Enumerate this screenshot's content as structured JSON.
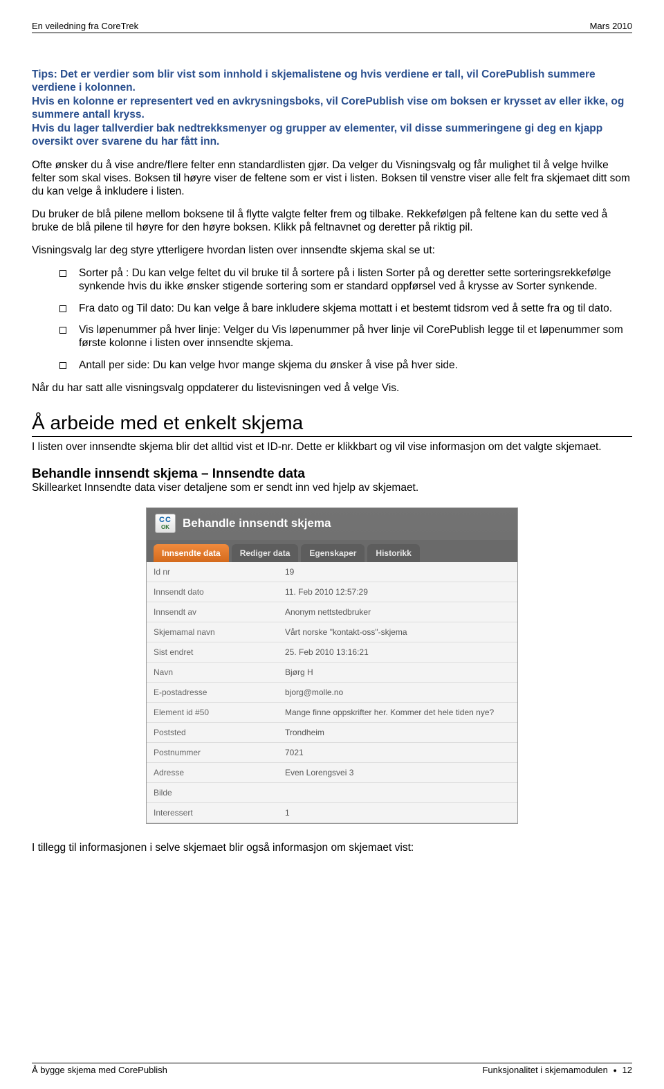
{
  "header": {
    "left": "En veiledning fra CoreTrek",
    "right": "Mars 2010"
  },
  "tips": "Tips: Det er verdier som blir vist som innhold i skjemalistene og hvis verdiene er tall, vil CorePublish summere verdiene i kolonnen.\nHvis en kolonne er representert ved en avkrysningsboks, vil CorePublish vise om boksen er krysset av eller ikke, og summere antall kryss.\nHvis du lager tallverdier bak nedtrekksmenyer og grupper av elementer, vil disse summeringene gi deg en kjapp oversikt over svarene du har fått inn.",
  "p1": "Ofte ønsker du å vise andre/flere felter enn standardlisten gjør. Da velger du Visningsvalg og får mulighet til å velge hvilke felter som skal vises. Boksen til høyre viser de feltene som er vist i listen. Boksen til venstre viser alle felt fra skjemaet ditt som du kan velge å inkludere i listen.",
  "p2": "Du bruker de blå pilene mellom boksene til å flytte valgte felter frem og tilbake. Rekkefølgen på feltene kan du sette ved å bruke de blå pilene til høyre for den høyre boksen. Klikk på feltnavnet og deretter på riktig pil.",
  "p3": "Visningsvalg lar deg styre ytterligere hvordan listen over innsendte skjema skal se ut:",
  "bullets": [
    "Sorter på : Du kan velge feltet du vil bruke til å sortere på i listen Sorter på og deretter sette sorteringsrekkefølge synkende hvis du ikke ønsker stigende sortering som er standard oppførsel ved å krysse av Sorter synkende.",
    "Fra dato og Til dato: Du kan velge å bare inkludere skjema mottatt i et bestemt tidsrom ved å sette fra og til dato.",
    "Vis løpenummer på hver linje: Velger du Vis løpenummer på hver linje vil CorePublish legge til et løpenummer som første kolonne i listen over innsendte skjema.",
    "Antall per side: Du kan velge hvor mange skjema du ønsker å vise på hver side."
  ],
  "p4": "Når du har satt alle visningsvalg oppdaterer du listevisningen ved å velge Vis.",
  "section_title": "Å arbeide med et enkelt skjema",
  "p5": "I listen over innsendte skjema blir det alltid vist et ID-nr. Dette er klikkbart og vil vise informasjon om det valgte skjemaet.",
  "sub_title": "Behandle innsendt skjema – Innsendte data",
  "sub_desc": "Skillearket Innsendte data viser detaljene som er sendt inn ved hjelp av skjemaet.",
  "screenshot": {
    "app_icon_top": "CC",
    "app_icon_bottom": "OK",
    "title": "Behandle innsendt skjema",
    "tabs": [
      "Innsendte data",
      "Rediger data",
      "Egenskaper",
      "Historikk"
    ],
    "rows": [
      {
        "k": "Id nr",
        "v": "19"
      },
      {
        "k": "Innsendt dato",
        "v": "11. Feb 2010 12:57:29"
      },
      {
        "k": "Innsendt av",
        "v": "Anonym nettstedbruker"
      },
      {
        "k": "Skjemamal navn",
        "v": "Vårt norske \"kontakt-oss\"-skjema"
      },
      {
        "k": "Sist endret",
        "v": "25. Feb 2010 13:16:21"
      },
      {
        "k": "Navn",
        "v": "Bjørg H"
      },
      {
        "k": "E-postadresse",
        "v": "bjorg@molle.no"
      },
      {
        "k": "Element id #50",
        "v": "Mange finne oppskrifter her. Kommer det hele tiden nye?"
      },
      {
        "k": "Poststed",
        "v": "Trondheim"
      },
      {
        "k": "Postnummer",
        "v": "7021"
      },
      {
        "k": "Adresse",
        "v": "Even Lorengsvei 3"
      },
      {
        "k": "Bilde",
        "v": ""
      },
      {
        "k": "Interessert",
        "v": "1"
      }
    ]
  },
  "p6": "I tillegg til informasjonen i selve skjemaet blir også informasjon om skjemaet vist:",
  "footer": {
    "left": "Å bygge skjema med CorePublish",
    "right_label": "Funksjonalitet i skjemamodulen",
    "right_page": "12"
  }
}
